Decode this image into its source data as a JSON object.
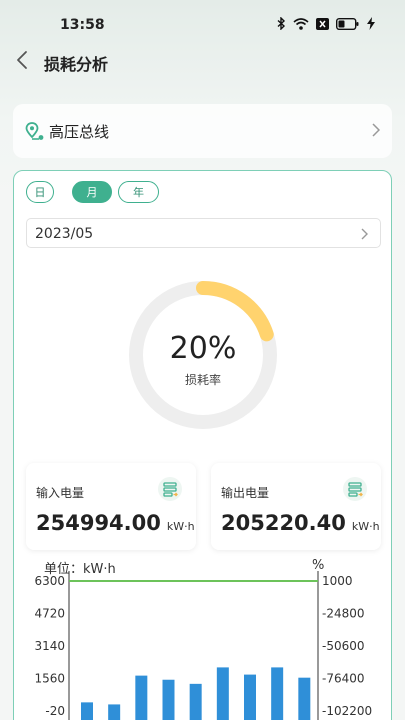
{
  "status": {
    "time": "13:58"
  },
  "header": {
    "title": "损耗分析"
  },
  "line_selector": {
    "name": "高压总线"
  },
  "period_tabs": [
    {
      "label": "日",
      "active": false
    },
    {
      "label": "月",
      "active": true
    },
    {
      "label": "年",
      "active": false
    }
  ],
  "date_picker": {
    "value": "2023/05"
  },
  "loss_rate": {
    "value_text": "20%",
    "label": "损耗率",
    "value": 0.2
  },
  "input_energy": {
    "title": "输入电量",
    "value": "254994.00",
    "unit": "kW·h"
  },
  "output_energy": {
    "title": "输出电量",
    "value": "205220.40",
    "unit": "kW·h"
  },
  "chart_header": {
    "left_unit": "单位：kW·h",
    "right_unit": "%"
  },
  "colors": {
    "accent": "#3fb08f",
    "donut_fill": "#ffd36e",
    "donut_track": "#eeeeee",
    "bar": "#2f8fd8",
    "line": "#6cc35a"
  },
  "chart_data": {
    "type": "bar",
    "left_axis": {
      "ticks": [
        "6300",
        "4720",
        "3140",
        "1560",
        "-20"
      ],
      "range": [
        -20,
        6300
      ]
    },
    "right_axis": {
      "ticks": [
        "1000",
        "-24800",
        "-50600",
        "-76400",
        "-102200"
      ],
      "range": [
        -102200,
        1000
      ]
    },
    "series": [
      {
        "type": "bar",
        "axis": "left",
        "values": [
          400,
          300,
          1700,
          1500,
          1300,
          2100,
          1750,
          2100,
          1600
        ]
      },
      {
        "type": "line",
        "axis": "right",
        "values": [
          1000,
          1000,
          1000,
          1000,
          1000,
          1000,
          1000,
          1000,
          1000
        ]
      }
    ]
  }
}
